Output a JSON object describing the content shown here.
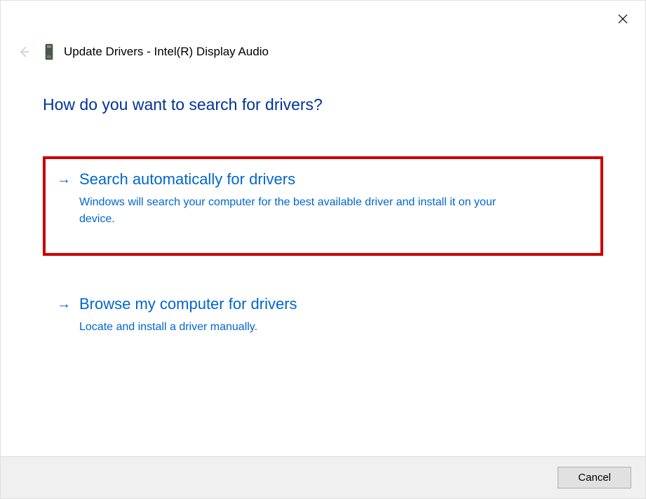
{
  "header": {
    "title": "Update Drivers - Intel(R) Display Audio"
  },
  "question": "How do you want to search for drivers?",
  "options": [
    {
      "title": "Search automatically for drivers",
      "description": "Windows will search your computer for the best available driver and install it on your device."
    },
    {
      "title": "Browse my computer for drivers",
      "description": "Locate and install a driver manually."
    }
  ],
  "footer": {
    "cancel": "Cancel"
  }
}
